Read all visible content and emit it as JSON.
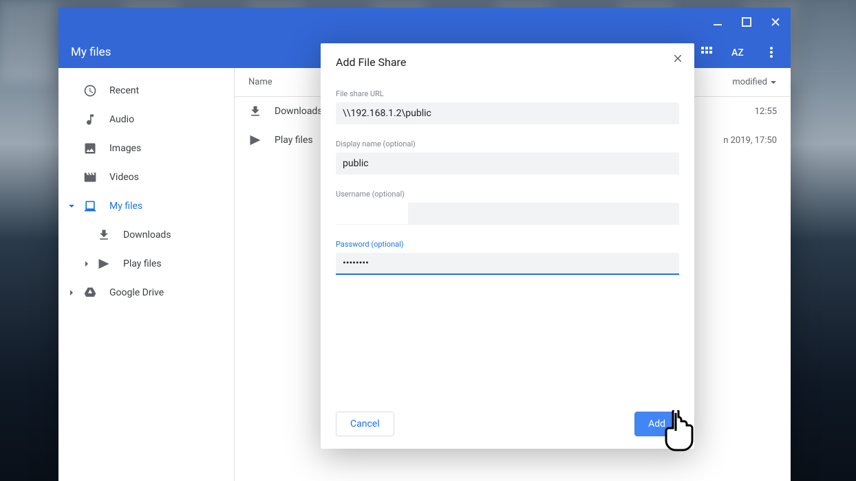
{
  "header": {
    "title": "My files"
  },
  "sidebar": {
    "recent": "Recent",
    "audio": "Audio",
    "images": "Images",
    "videos": "Videos",
    "myfiles": "My files",
    "downloads": "Downloads",
    "playfiles": "Play files",
    "googledrive": "Google Drive"
  },
  "columns": {
    "name": "Name",
    "modified": "modified"
  },
  "rows": [
    {
      "name": "Downloads",
      "modified": "12:55"
    },
    {
      "name": "Play files",
      "modified": "n 2019, 17:50"
    }
  ],
  "dialog": {
    "title": "Add File Share",
    "url_label": "File share URL",
    "url_value": "\\\\192.168.1.2\\public",
    "display_label": "Display name (optional)",
    "display_value": "public",
    "username_label": "Username (optional)",
    "username_value": "",
    "password_label": "Password (optional)",
    "password_value": "••••••••",
    "cancel": "Cancel",
    "add": "Add"
  }
}
